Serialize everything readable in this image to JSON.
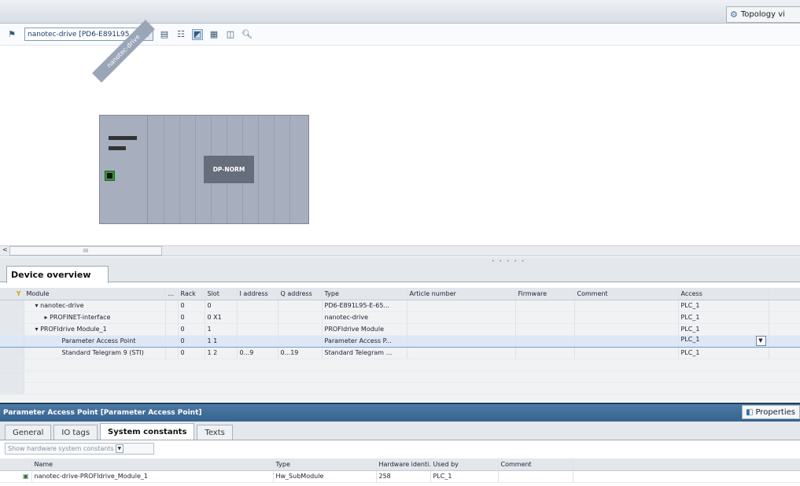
{
  "topbar": {
    "topology_tab": "Topology vi"
  },
  "toolbar": {
    "device_select": "nanotec-drive [PD6-E891L95"
  },
  "canvas": {
    "device_label": "nanotec-drive",
    "module_label": "DP-NORM"
  },
  "scrollbar": {
    "left_arrow": "<",
    "thumb_grip": "III"
  },
  "overview": {
    "tab_label": "Device overview",
    "columns": [
      "Module",
      "...",
      "Rack",
      "Slot",
      "I address",
      "Q address",
      "Type",
      "Article number",
      "Firmware",
      "Comment",
      "Access"
    ],
    "rows": [
      {
        "module": "nanotec-drive",
        "rack": "0",
        "slot": "0",
        "i_addr": "",
        "q_addr": "",
        "type": "PD6-E891L95-E-65...",
        "article": "",
        "firmware": "",
        "comment": "",
        "access": "PLC_1"
      },
      {
        "module": "PROFINET-interface",
        "rack": "0",
        "slot": "0 X1",
        "i_addr": "",
        "q_addr": "",
        "type": "nanotec-drive",
        "article": "",
        "firmware": "",
        "comment": "",
        "access": "PLC_1"
      },
      {
        "module": "PROFIdrive Module_1",
        "rack": "0",
        "slot": "1",
        "i_addr": "",
        "q_addr": "",
        "type": "PROFIdrive Module",
        "article": "",
        "firmware": "",
        "comment": "",
        "access": "PLC_1"
      },
      {
        "module": "Parameter Access Point",
        "rack": "0",
        "slot": "1 1",
        "i_addr": "",
        "q_addr": "",
        "type": "Parameter Access P...",
        "article": "",
        "firmware": "",
        "comment": "",
        "access": "PLC_1"
      },
      {
        "module": "Standard Telegram 9 (STI)",
        "rack": "0",
        "slot": "1 2",
        "i_addr": "0...9",
        "q_addr": "0...19",
        "type": "Standard Telegram ...",
        "article": "",
        "firmware": "",
        "comment": "",
        "access": "PLC_1"
      }
    ]
  },
  "properties": {
    "title": "Parameter Access Point [Parameter Access Point]",
    "button_label": "Properties",
    "tabs": [
      "General",
      "IO tags",
      "System constants",
      "Texts"
    ],
    "active_tab": "System constants",
    "filter": "Show hardware system constants",
    "columns": [
      "Name",
      "Type",
      "Hardware identi.",
      "Used by",
      "Comment"
    ],
    "rows": [
      {
        "name": "nanotec-drive-PROFIdrive_Module_1",
        "type": "Hw_SubModule",
        "hw_id": "258",
        "used_by": "PLC_1",
        "comment": ""
      }
    ]
  }
}
